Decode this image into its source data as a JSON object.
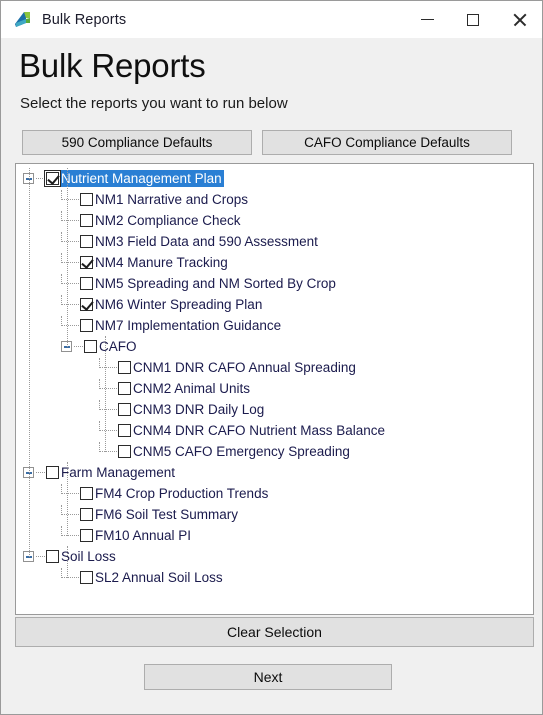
{
  "window": {
    "title": "Bulk Reports",
    "icon": "app-logo-icon",
    "controls": {
      "minimize": "—",
      "maximize": "□",
      "close": "✕"
    }
  },
  "header": {
    "title": "Bulk Reports",
    "subtitle": "Select the reports you want to run below"
  },
  "toolbar": {
    "defaults_590_label": "590 Compliance Defaults",
    "defaults_cafo_label": "CAFO Compliance Defaults"
  },
  "colors": {
    "selection_blue": "#2a7fd4",
    "label_text": "#1b1b4d",
    "window_chrome": "#f0f0f0",
    "button_face": "#e1e1e1",
    "tree_background": "#ffffff"
  },
  "tree": {
    "nodes": [
      {
        "id": "nmp",
        "label": "Nutrient Management Plan",
        "level": 0,
        "checked": true,
        "selected": true,
        "expandable": true
      },
      {
        "id": "nm1",
        "label": "NM1 Narrative and Crops",
        "level": 1,
        "checked": false,
        "selected": false,
        "expandable": false
      },
      {
        "id": "nm2",
        "label": "NM2 Compliance Check",
        "level": 1,
        "checked": false,
        "selected": false,
        "expandable": false
      },
      {
        "id": "nm3",
        "label": "NM3 Field Data and 590 Assessment",
        "level": 1,
        "checked": false,
        "selected": false,
        "expandable": false
      },
      {
        "id": "nm4",
        "label": "NM4 Manure Tracking",
        "level": 1,
        "checked": true,
        "selected": false,
        "expandable": false
      },
      {
        "id": "nm5",
        "label": "NM5 Spreading and NM Sorted By Crop",
        "level": 1,
        "checked": false,
        "selected": false,
        "expandable": false
      },
      {
        "id": "nm6",
        "label": "NM6 Winter Spreading Plan",
        "level": 1,
        "checked": true,
        "selected": false,
        "expandable": false
      },
      {
        "id": "nm7",
        "label": "NM7 Implementation Guidance",
        "level": 1,
        "checked": false,
        "selected": false,
        "expandable": false
      },
      {
        "id": "cafo",
        "label": "CAFO",
        "level": 2,
        "checked": false,
        "selected": false,
        "expandable": true
      },
      {
        "id": "cnm1",
        "label": "CNM1 DNR CAFO Annual Spreading",
        "level": 3,
        "checked": false,
        "selected": false,
        "expandable": false
      },
      {
        "id": "cnm2",
        "label": "CNM2 Animal Units",
        "level": 3,
        "checked": false,
        "selected": false,
        "expandable": false
      },
      {
        "id": "cnm3",
        "label": "CNM3 DNR Daily Log",
        "level": 3,
        "checked": false,
        "selected": false,
        "expandable": false
      },
      {
        "id": "cnm4",
        "label": "CNM4 DNR CAFO Nutrient Mass Balance",
        "level": 3,
        "checked": false,
        "selected": false,
        "expandable": false
      },
      {
        "id": "cnm5",
        "label": "CNM5 CAFO Emergency Spreading",
        "level": 3,
        "checked": false,
        "selected": false,
        "expandable": false
      },
      {
        "id": "fm",
        "label": "Farm Management",
        "level": 0,
        "checked": false,
        "selected": false,
        "expandable": true
      },
      {
        "id": "fm4",
        "label": "FM4 Crop Production Trends",
        "level": 1,
        "checked": false,
        "selected": false,
        "expandable": false
      },
      {
        "id": "fm6",
        "label": "FM6 Soil Test Summary",
        "level": 1,
        "checked": false,
        "selected": false,
        "expandable": false
      },
      {
        "id": "fm10",
        "label": "FM10 Annual PI",
        "level": 1,
        "checked": false,
        "selected": false,
        "expandable": false
      },
      {
        "id": "sl",
        "label": "Soil Loss",
        "level": 0,
        "checked": false,
        "selected": false,
        "expandable": true
      },
      {
        "id": "sl2",
        "label": "SL2 Annual Soil Loss",
        "level": 1,
        "checked": false,
        "selected": false,
        "expandable": false
      }
    ]
  },
  "footer": {
    "clear_label": "Clear Selection",
    "next_label": "Next"
  }
}
